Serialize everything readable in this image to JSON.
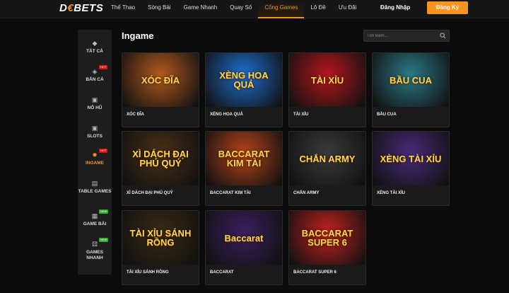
{
  "header": {
    "logo_prefix": "D",
    "logo_o": "€",
    "logo_suffix": "BETS",
    "nav": [
      {
        "label": "Thể Thao",
        "active": false
      },
      {
        "label": "Sòng Bài",
        "active": false
      },
      {
        "label": "Game Nhanh",
        "active": false
      },
      {
        "label": "Quay Số",
        "active": false
      },
      {
        "label": "Cổng Games",
        "active": true
      },
      {
        "label": "Lô Đề",
        "active": false
      },
      {
        "label": "Ưu Đãi",
        "active": false
      }
    ],
    "login_label": "Đăng Nhập",
    "signup_label": "Đăng Ký",
    "accent_color": "#f7931e"
  },
  "sidebar": {
    "items": [
      {
        "label": "TẤT CẢ",
        "icon": "all-icon",
        "tag": ""
      },
      {
        "label": "BẮN CÁ",
        "icon": "fish-icon",
        "tag": "HOT"
      },
      {
        "label": "NỔ HŨ",
        "icon": "jackpot-icon",
        "tag": ""
      },
      {
        "label": "SLOTS",
        "icon": "slot-icon",
        "tag": ""
      },
      {
        "label": "INGAME",
        "icon": "ingame-icon",
        "tag": "HOT"
      },
      {
        "label": "TABLE GAMES",
        "icon": "cards-icon",
        "tag": ""
      },
      {
        "label": "GAME BÀI",
        "icon": "card-game-icon",
        "tag": "NEW"
      },
      {
        "label": "GAMES NHANH",
        "icon": "dice-icon",
        "tag": "NEW"
      }
    ],
    "active_index": 4
  },
  "main": {
    "title": "Ingame",
    "search_placeholder": "Tìm kiếm...",
    "games": [
      {
        "name": "XÓC ĐĨA",
        "art": "XÓC ĐĨA",
        "bg": "#b35a1e"
      },
      {
        "name": "XÈNG HOA QUẢ",
        "art": "XÈNG HOA QUẢ",
        "bg": "#1e6fd0"
      },
      {
        "name": "TÀI XỈU",
        "art": "TÀI XỈU",
        "bg": "#b5161c"
      },
      {
        "name": "BẦU CUA",
        "art": "BẦU CUA",
        "bg": "#2b7a86"
      },
      {
        "name": "XÌ DÁCH ĐẠI PHÚ QUÝ",
        "art": "XÌ DÁCH ĐẠI PHÚ QUÝ",
        "bg": "#4a3016"
      },
      {
        "name": "BACCARAT KIM TÀI",
        "art": "BACCARAT KIM TÀI",
        "bg": "#b8431a"
      },
      {
        "name": "CHẮN ARMY",
        "art": "CHẮN ARMY",
        "bg": "#3b3b3b"
      },
      {
        "name": "XÈNG TÀI XỈU",
        "art": "XÈNG TÀI XỈU",
        "bg": "#4a2a7a"
      },
      {
        "name": "TÀI XỈU SÁNH RỒNG",
        "art": "TÀI XỈU SÁNH RỒNG",
        "bg": "#3a2a12"
      },
      {
        "name": "BACCARAT",
        "art": "Baccarat",
        "bg": "#3a1f5e"
      },
      {
        "name": "BACCARAT SUPER 6",
        "art": "BACCARAT SUPER 6",
        "bg": "#c4221f"
      }
    ]
  }
}
